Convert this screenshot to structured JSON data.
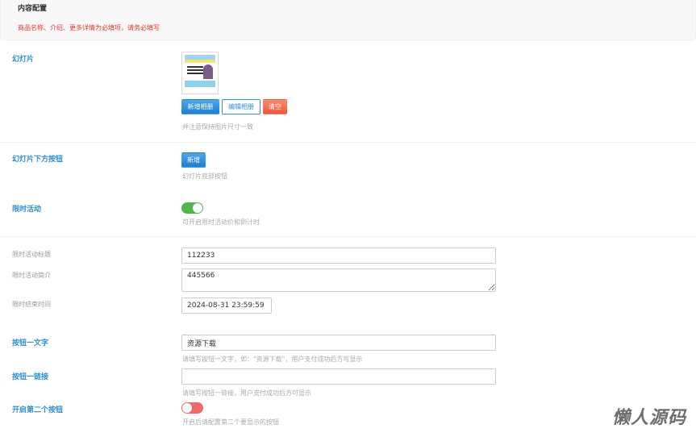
{
  "header": {
    "title": "内容配置",
    "note": "商品名称、介绍、更多详情为必填项，请务必填写"
  },
  "slides": {
    "label": "幻灯片",
    "add": "新增相册",
    "edit": "编辑相册",
    "clear": "清空",
    "hint": "并注意保持图片尺寸一致"
  },
  "slide_button": {
    "label": "幻灯片下方按钮",
    "add": "新增",
    "hint": "幻灯片底部按钮"
  },
  "limited": {
    "label": "限时活动",
    "enabled": true,
    "hint": "可开启限时活动价和倒计时",
    "title_label": "限时活动标题",
    "title_value": "112233",
    "intro_label": "限时活动简介",
    "intro_value": "445566",
    "end_label": "限时结束时间",
    "end_value": "2024-08-31 23:59:59"
  },
  "button1_text": {
    "label": "按钮一文字",
    "value": "资源下载",
    "hint": "请填写按钮一文字，如：\"资源下载\"，用户支付成功后方可显示"
  },
  "button1_link": {
    "label": "按钮一链接",
    "value": "",
    "hint": "请填写按钮一链接，用户支付成功后方可显示"
  },
  "button2": {
    "label": "开启第二个按钮",
    "enabled": false,
    "hint": "开启后请配置第二个要显示的按钮"
  },
  "watermark": "懒人源码",
  "colors": {
    "accent": "#2b8fd6",
    "on": "#4cb84c",
    "off": "#f06a6a",
    "danger": "#e33"
  }
}
